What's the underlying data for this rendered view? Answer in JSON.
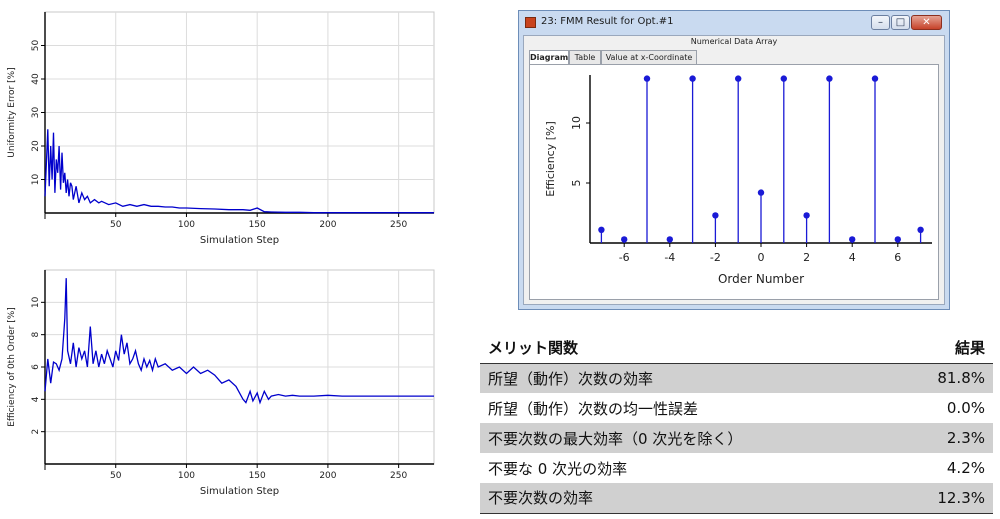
{
  "chart_data": [
    {
      "type": "line",
      "xlabel": "Simulation Step",
      "ylabel": "Uniformity Error [%]",
      "xlim": [
        0,
        275
      ],
      "ylim": [
        0,
        60
      ],
      "xticks": [
        50,
        100,
        150,
        200,
        250
      ],
      "yticks": [
        10,
        20,
        30,
        40,
        50
      ],
      "grid": true,
      "series": [
        {
          "color": "#0000cc",
          "x": [
            0,
            1,
            2,
            3,
            4,
            5,
            6,
            7,
            8,
            9,
            10,
            11,
            12,
            13,
            14,
            15,
            16,
            17,
            18,
            19,
            20,
            22,
            24,
            26,
            28,
            30,
            32,
            35,
            38,
            40,
            45,
            50,
            55,
            60,
            65,
            70,
            75,
            80,
            85,
            90,
            95,
            100,
            110,
            120,
            130,
            140,
            145,
            150,
            155,
            160,
            170,
            180,
            190,
            200,
            220,
            240,
            260,
            275
          ],
          "y": [
            5,
            15,
            25,
            8,
            20,
            10,
            24,
            6,
            16,
            12,
            20,
            7,
            18,
            9,
            12,
            6,
            10,
            5,
            9,
            8,
            4,
            8,
            3,
            6,
            4,
            5,
            3,
            4,
            3,
            3.5,
            2.5,
            3,
            2,
            2.5,
            2,
            2.5,
            2,
            2,
            1.8,
            1.8,
            1.5,
            1.5,
            1.3,
            1.2,
            1,
            1,
            0.8,
            1.5,
            0.4,
            0.3,
            0.2,
            0.2,
            0.1,
            0.1,
            0.1,
            0.1,
            0.1,
            0.1
          ]
        }
      ]
    },
    {
      "type": "line",
      "xlabel": "Simulation Step",
      "ylabel": "Efficiency of 0th Order [%]",
      "xlim": [
        0,
        275
      ],
      "ylim": [
        0,
        12
      ],
      "xticks": [
        50,
        100,
        150,
        200,
        250
      ],
      "yticks": [
        2,
        4,
        6,
        8,
        10
      ],
      "grid": true,
      "series": [
        {
          "color": "#0000cc",
          "x": [
            0,
            2,
            4,
            6,
            8,
            10,
            12,
            14,
            15,
            16,
            18,
            20,
            22,
            24,
            26,
            28,
            30,
            32,
            34,
            36,
            38,
            40,
            42,
            44,
            46,
            48,
            50,
            52,
            54,
            56,
            58,
            60,
            62,
            64,
            66,
            68,
            70,
            72,
            74,
            76,
            78,
            80,
            85,
            90,
            95,
            100,
            105,
            110,
            115,
            120,
            125,
            130,
            135,
            140,
            142,
            145,
            147,
            150,
            152,
            155,
            158,
            160,
            165,
            170,
            175,
            180,
            190,
            200,
            210,
            220,
            230,
            240,
            250,
            260,
            275
          ],
          "y": [
            4.5,
            6.5,
            5,
            6.3,
            6.2,
            5.8,
            6.5,
            9,
            11.5,
            7,
            6.2,
            7.5,
            6,
            7.2,
            6.5,
            7,
            6,
            8.5,
            6.2,
            7,
            6,
            6.8,
            6.2,
            7,
            6.5,
            6,
            7,
            6.4,
            8,
            6.8,
            7.5,
            6.2,
            6.5,
            7,
            6.2,
            5.8,
            6.5,
            6,
            6.4,
            5.8,
            6.5,
            6,
            6.2,
            5.8,
            6,
            5.6,
            6,
            5.6,
            5.8,
            5.5,
            5,
            5.2,
            4.8,
            4,
            3.8,
            4.5,
            3.9,
            4.4,
            3.8,
            4.5,
            4,
            4.2,
            4.3,
            4.2,
            4.25,
            4.2,
            4.2,
            4.25,
            4.2,
            4.2,
            4.2,
            4.2,
            4.2,
            4.2,
            4.2
          ]
        }
      ]
    },
    {
      "type": "scatter",
      "title": "",
      "xlabel": "Order Number",
      "ylabel": "Efficiency [%]",
      "xlim": [
        -7.5,
        7.5
      ],
      "ylim": [
        0,
        14
      ],
      "xticks": [
        -6,
        -4,
        -2,
        0,
        2,
        4,
        6
      ],
      "yticks": [
        5,
        10
      ],
      "grid": false,
      "series": [
        {
          "color": "#1a1ad6",
          "x": [
            -7,
            -6,
            -5,
            -4,
            -3,
            -2,
            -1,
            0,
            1,
            2,
            3,
            4,
            5,
            6,
            7
          ],
          "y": [
            1.1,
            0.3,
            13.7,
            0.3,
            13.7,
            2.3,
            13.7,
            4.2,
            13.7,
            2.3,
            13.7,
            0.3,
            13.7,
            0.3,
            1.1
          ]
        }
      ]
    }
  ],
  "window": {
    "title": "23: FMM Result for Opt.#1",
    "subtitle": "Numerical Data Array",
    "tabs": [
      "Diagram",
      "Table",
      "Value at x-Coordinate"
    ],
    "min_glyph": "–",
    "max_glyph": "□",
    "close_glyph": "✕"
  },
  "merit_table": {
    "header": {
      "name": "メリット関数",
      "value": "結果"
    },
    "rows": [
      {
        "name": "所望（動作）次数の効率",
        "value": "81.8%"
      },
      {
        "name": "所望（動作）次数の均一性誤差",
        "value": "0.0%"
      },
      {
        "name": "不要次数の最大効率（0 次光を除く）",
        "value": "2.3%"
      },
      {
        "name": "不要な 0 次光の効率",
        "value": "4.2%"
      },
      {
        "name": "不要次数の効率",
        "value": "12.3%"
      }
    ]
  }
}
